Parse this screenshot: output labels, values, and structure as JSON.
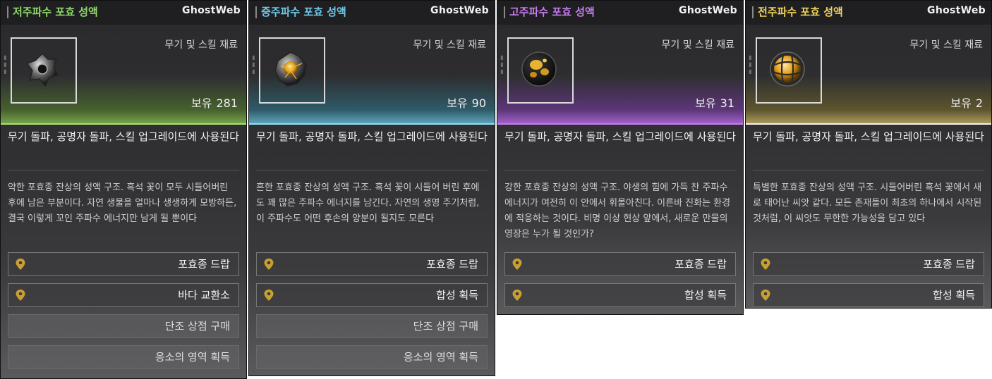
{
  "watermark": "GhostWeb",
  "cards": [
    {
      "title": "저주파수 포효 성액",
      "title_color": "#8fd96a",
      "type": "무기 및 스킬 재료",
      "owned_label": "보유",
      "owned_value": "281",
      "glow_color": "#5a8a2e",
      "usage": "무기 돌파, 공명자 돌파, 스킬 업그레이드에 사용된다",
      "description": "약한 포효종 잔상의 성액 구조. 흑석 꽃이 모두 시들어버린 후에 남은 부분이다. 자연 생물을 얼마나 생생하게 모방하든, 결국 이렇게 꼬인 주파수 에너지만 남게 될 뿐이다",
      "buttons": [
        {
          "label": "포효종 드랍",
          "icon": "location-pin-icon"
        },
        {
          "label": "바다 교환소",
          "icon": "location-pin-icon"
        },
        {
          "label": "단조 상점 구매",
          "icon": ""
        },
        {
          "label": "응소의 영역 획득",
          "icon": ""
        }
      ]
    },
    {
      "title": "중주파수 포효 성액",
      "title_color": "#6fc8e8",
      "type": "무기 및 스킬 재료",
      "owned_label": "보유",
      "owned_value": "90",
      "glow_color": "#2f7f96",
      "usage": "무기 돌파, 공명자 돌파, 스킬 업그레이드에 사용된다",
      "description": "흔한 포효종 잔상의 성액 구조. 흑석 꽃이 시들어 버린 후에도 꽤 많은 주파수 에너지를 남긴다. 자연의 생명 주기처럼, 이 주파수도 어떤 후손의 양분이 될지도 모른다",
      "buttons": [
        {
          "label": "포효종 드랍",
          "icon": "location-pin-icon"
        },
        {
          "label": "합성 획득",
          "icon": "location-pin-icon"
        },
        {
          "label": "단조 상점 구매",
          "icon": ""
        },
        {
          "label": "응소의 영역 획득",
          "icon": ""
        }
      ]
    },
    {
      "title": "고주파수 포효 성액",
      "title_color": "#c77af0",
      "type": "무기 및 스킬 재료",
      "owned_label": "보유",
      "owned_value": "31",
      "glow_color": "#7a3aa8",
      "usage": "무기 돌파, 공명자 돌파, 스킬 업그레이드에 사용된다",
      "description": "강한 포효종 잔상의 성액 구조. 야생의 힘에 가득 찬 주파수 에너지가 여전히 이 안에서 휘몰아친다. 이른바 진화는 환경에 적응하는 것이다. 비명 이상 현상 앞에서, 새로운 만물의 영장은 누가 될 것인가?",
      "buttons": [
        {
          "label": "포효종 드랍",
          "icon": "location-pin-icon"
        },
        {
          "label": "합성 획득",
          "icon": "location-pin-icon"
        }
      ]
    },
    {
      "title": "전주파수 포효 성액",
      "title_color": "#f0d25a",
      "type": "무기 및 스킬 재료",
      "owned_label": "보유",
      "owned_value": "2",
      "glow_color": "#8a7a2a",
      "usage": "무기 돌파, 공명자 돌파, 스킬 업그레이드에 사용된다",
      "description": "특별한 포효종 잔상의 성액 구조. 시들어버린 흑석 꽃에서 새로 태어난 씨앗 같다. 모든 존재들이 최초의 하나에서 시작된 것처럼, 이 씨앗도 무한한 가능성을 담고 있다",
      "buttons": [
        {
          "label": "포효종 드랍",
          "icon": "location-pin-icon"
        },
        {
          "label": "합성 획득",
          "icon": "location-pin-icon"
        }
      ]
    }
  ]
}
